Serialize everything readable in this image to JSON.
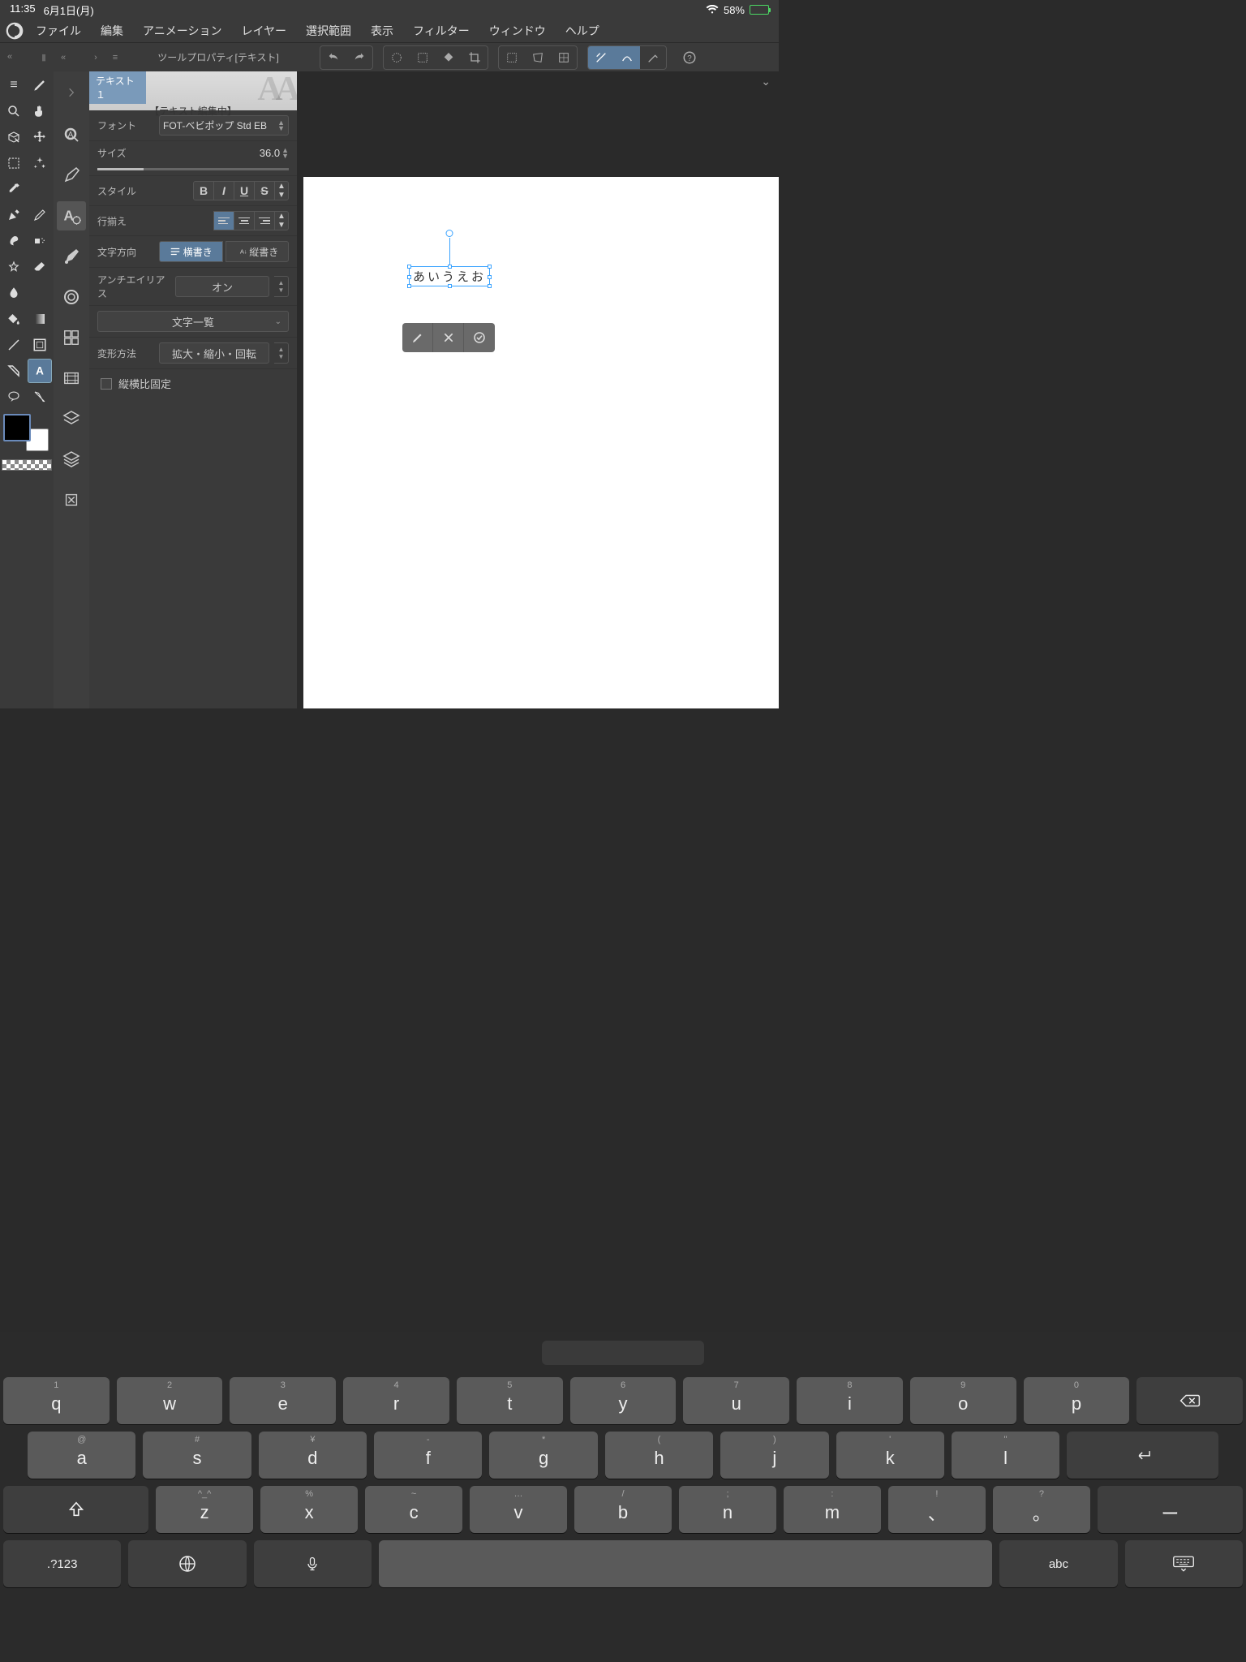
{
  "status": {
    "time": "11:35",
    "date": "6月1日(月)",
    "battery": "58%"
  },
  "menu": {
    "items": [
      "ファイル",
      "編集",
      "アニメーション",
      "レイヤー",
      "選択範囲",
      "表示",
      "フィルター",
      "ウィンドウ",
      "ヘルプ"
    ]
  },
  "tool_property": {
    "title": "ツールプロパティ[テキスト]",
    "tab": "テキスト１",
    "editing": "【テキスト編集中】",
    "font_label": "フォント",
    "font_value": "FOT-ベビポップ Std EB",
    "size_label": "サイズ",
    "size_value": "36.0",
    "style_label": "スタイル",
    "align_label": "行揃え",
    "direction_label": "文字方向",
    "direction_horiz": "横書き",
    "direction_vert": "縦書き",
    "antialias_label": "アンチエイリアス",
    "antialias_value": "オン",
    "charlist_label": "文字一覧",
    "transform_label": "変形方法",
    "transform_value": "拡大・縮小・回転",
    "aspect_lock": "縦横比固定"
  },
  "canvas": {
    "text_content": "あいうえお"
  },
  "keyboard": {
    "row1": [
      {
        "sub": "1",
        "main": "q"
      },
      {
        "sub": "2",
        "main": "w"
      },
      {
        "sub": "3",
        "main": "e"
      },
      {
        "sub": "4",
        "main": "r"
      },
      {
        "sub": "5",
        "main": "t"
      },
      {
        "sub": "6",
        "main": "y"
      },
      {
        "sub": "7",
        "main": "u"
      },
      {
        "sub": "8",
        "main": "i"
      },
      {
        "sub": "9",
        "main": "o"
      },
      {
        "sub": "0",
        "main": "p"
      }
    ],
    "row2": [
      {
        "sub": "@",
        "main": "a"
      },
      {
        "sub": "#",
        "main": "s"
      },
      {
        "sub": "¥",
        "main": "d"
      },
      {
        "sub": "-",
        "main": "f"
      },
      {
        "sub": "*",
        "main": "g"
      },
      {
        "sub": "(",
        "main": "h"
      },
      {
        "sub": ")",
        "main": "j"
      },
      {
        "sub": "'",
        "main": "k"
      },
      {
        "sub": "\"",
        "main": "l"
      }
    ],
    "row3": [
      {
        "sub": "^_^",
        "main": "z"
      },
      {
        "sub": "%",
        "main": "x"
      },
      {
        "sub": "~",
        "main": "c"
      },
      {
        "sub": "…",
        "main": "v"
      },
      {
        "sub": "/",
        "main": "b"
      },
      {
        "sub": ";",
        "main": "n"
      },
      {
        "sub": ":",
        "main": "m"
      },
      {
        "sub": "!",
        "main": "、"
      },
      {
        "sub": "?",
        "main": "。"
      }
    ],
    "numkey": ".?123",
    "abc": "abc",
    "minus": "ー"
  }
}
